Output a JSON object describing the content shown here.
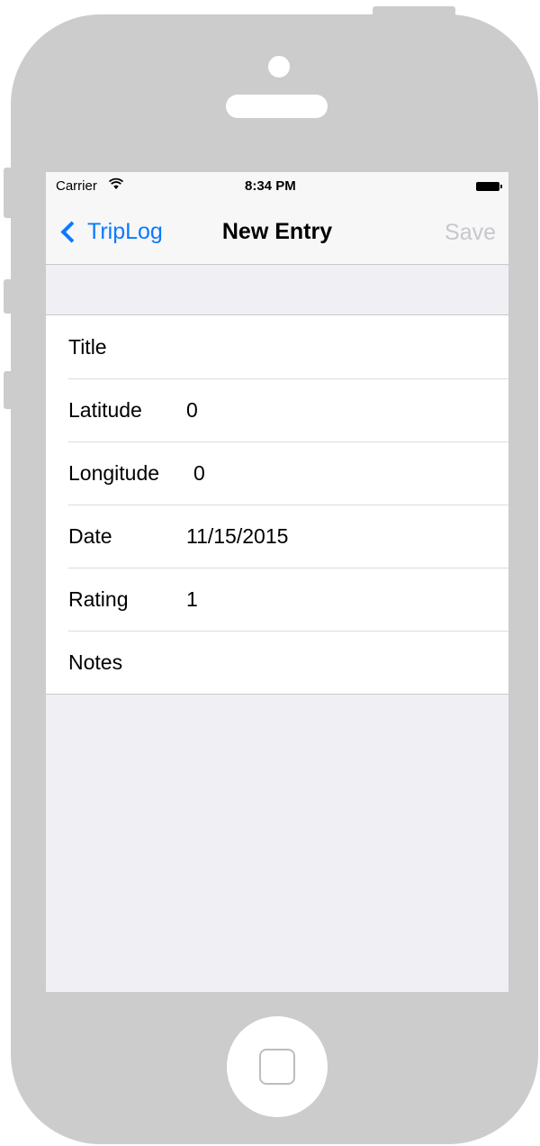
{
  "status_bar": {
    "carrier": "Carrier",
    "wifi_icon": "wifi-icon",
    "time": "8:34 PM",
    "battery_icon": "battery-icon"
  },
  "nav": {
    "back_label": "TripLog",
    "title": "New Entry",
    "save_label": "Save"
  },
  "form": {
    "rows": [
      {
        "label": "Title",
        "value": ""
      },
      {
        "label": "Latitude",
        "value": "0"
      },
      {
        "label": "Longitude",
        "value": "0"
      },
      {
        "label": "Date",
        "value": "11/15/2015"
      },
      {
        "label": "Rating",
        "value": "1"
      },
      {
        "label": "Notes",
        "value": ""
      }
    ]
  },
  "colors": {
    "accent": "#0a7aff",
    "disabled": "#c7c7cc",
    "grouped_background": "#efeff4",
    "device_frame": "#cccccc"
  }
}
